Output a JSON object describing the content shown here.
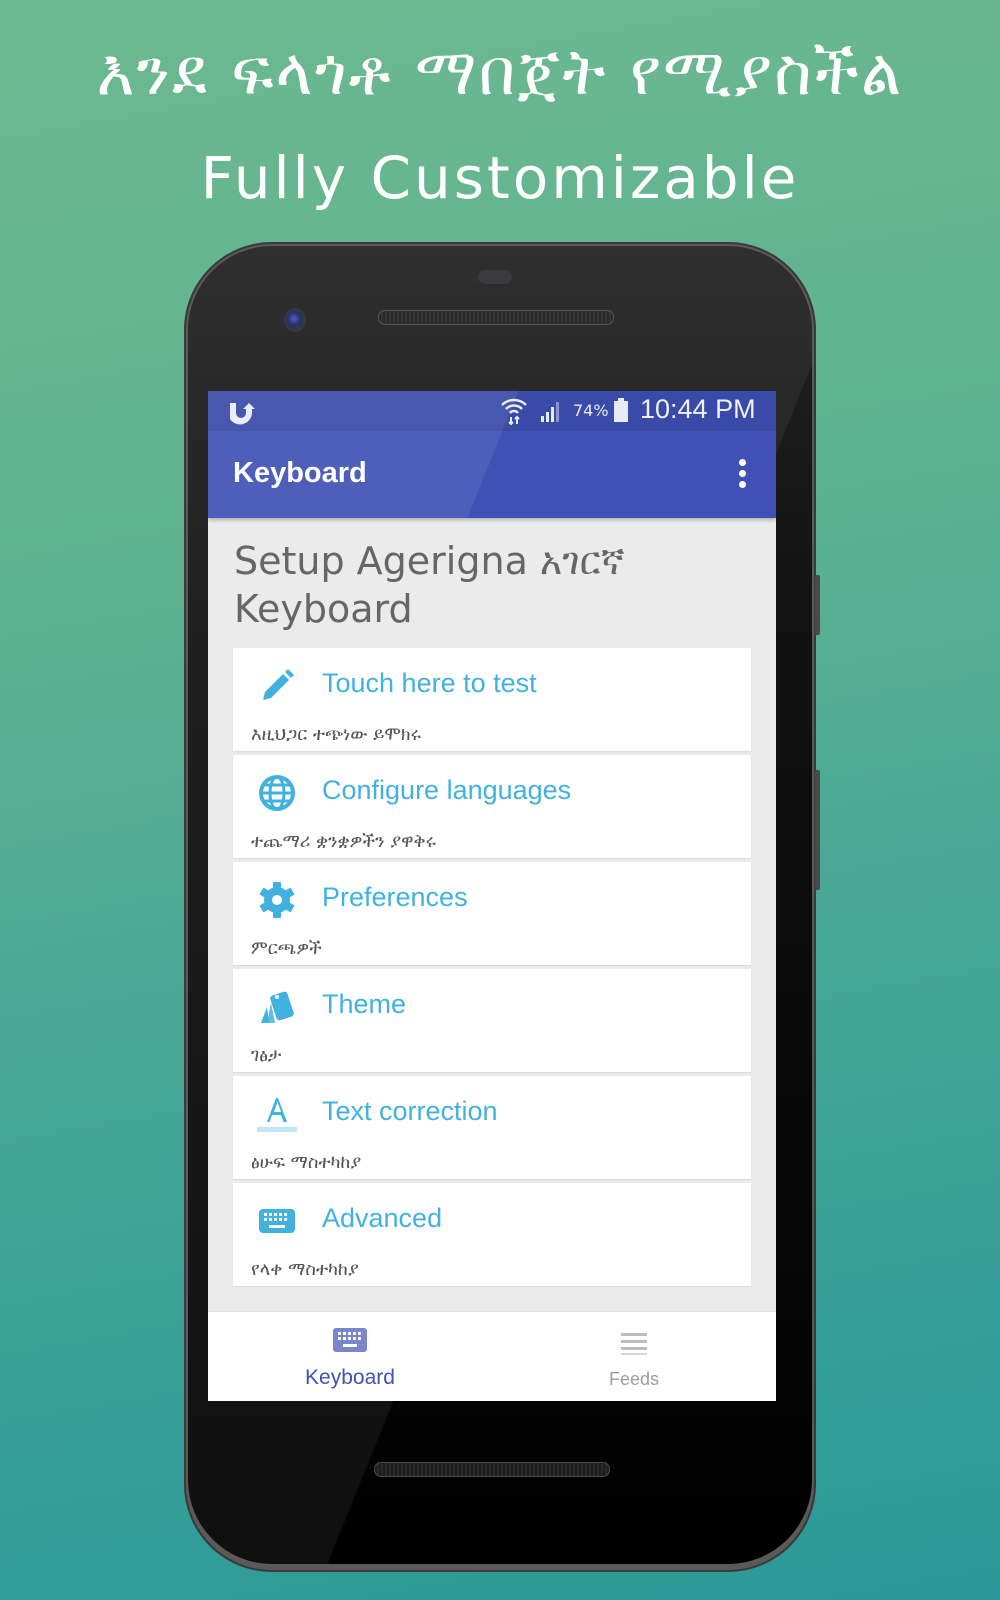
{
  "promo": {
    "headline_amharic": "እንደ ፍላጎቶ ማበጀት የሚያስችል",
    "headline_english": "Fully Customizable"
  },
  "status_bar": {
    "app_icon": "uc-browser-icon",
    "wifi_icon": "wifi-icon",
    "signal_icon": "cell-signal-icon",
    "battery_percent": "74%",
    "battery_icon": "battery-icon",
    "time": "10:44 PM"
  },
  "app_bar": {
    "title": "Keyboard",
    "menu_icon": "more-vert-icon"
  },
  "setup_title": "Setup Agerigna አገርኛ Keyboard",
  "menu_items": [
    {
      "label": "Touch here to test",
      "subtitle": "እዚህጋር ተጭነው ይሞክሩ",
      "icon": "pencil-icon"
    },
    {
      "label": "Configure languages",
      "subtitle": "ተጨማሪ ቋንቋዎችን ያዋቅሩ",
      "icon": "globe-icon"
    },
    {
      "label": "Preferences",
      "subtitle": "ምርጫዎች",
      "icon": "gear-icon"
    },
    {
      "label": "Theme",
      "subtitle": "ገፅታ",
      "icon": "theme-cards-icon"
    },
    {
      "label": "Text correction",
      "subtitle": "ፅሁፍ ማስተካከያ",
      "icon": "text-format-icon"
    },
    {
      "label": "Advanced",
      "subtitle": "የላቀ ማስተካከያ",
      "icon": "keyboard-icon"
    }
  ],
  "bottom_nav": [
    {
      "label": "Keyboard",
      "icon": "keyboard-icon",
      "active": true
    },
    {
      "label": "Feeds",
      "icon": "menu-lines-icon",
      "active": false
    }
  ],
  "colors": {
    "primary": "#3f51b5",
    "status_bar": "#3a4aa8",
    "accent": "#41b2e0",
    "background_top": "#6db98f",
    "background_bottom": "#2a9898"
  }
}
